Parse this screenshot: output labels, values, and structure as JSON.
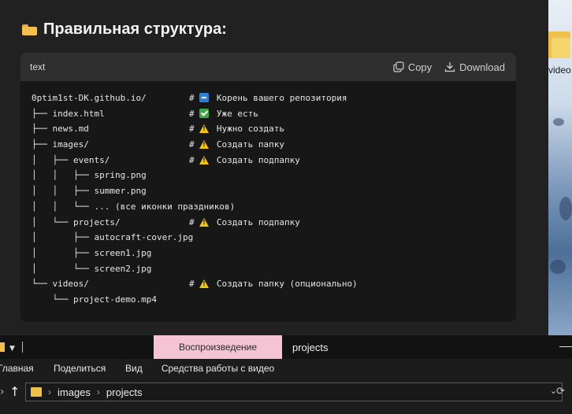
{
  "heading": {
    "text": "Правильная структура:"
  },
  "codeblock": {
    "language": "text",
    "copy_label": "Copy",
    "download_label": "Download",
    "lines": [
      {
        "tree": "0ptim1st-DK.github.io/",
        "mark": "back",
        "comment": "Корень вашего репозитория"
      },
      {
        "tree": "├── index.html",
        "mark": "check",
        "comment": "Уже есть"
      },
      {
        "tree": "├── news.md",
        "mark": "warn",
        "comment": "Нужно создать"
      },
      {
        "tree": "├── images/",
        "mark": "warn",
        "comment": "Создать папку"
      },
      {
        "tree": "│   ├── events/",
        "mark": "warn",
        "comment": "Создать подпапку"
      },
      {
        "tree": "│   │   ├── spring.png",
        "mark": "",
        "comment": ""
      },
      {
        "tree": "│   │   ├── summer.png",
        "mark": "",
        "comment": ""
      },
      {
        "tree": "│   │   └── ... (все иконки праздников)",
        "mark": "",
        "comment": ""
      },
      {
        "tree": "│   └── projects/",
        "mark": "warn",
        "comment": "Создать подпапку"
      },
      {
        "tree": "│       ├── autocraft-cover.jpg",
        "mark": "",
        "comment": ""
      },
      {
        "tree": "│       ├── screen1.jpg",
        "mark": "",
        "comment": ""
      },
      {
        "tree": "│       └── screen2.jpg",
        "mark": "",
        "comment": ""
      },
      {
        "tree": "└── videos/",
        "mark": "warn",
        "comment": "Создать папку (опционально)"
      },
      {
        "tree": "    └── project-demo.mp4",
        "mark": "",
        "comment": ""
      }
    ]
  },
  "desktop": {
    "icon_label": "video"
  },
  "explorer": {
    "context_tab": "Воспроизведение",
    "window_title": "projects",
    "ribbon": {
      "home": "Главная",
      "share": "Поделиться",
      "view": "Вид",
      "video_tools": "Средства работы с видео"
    },
    "breadcrumb": [
      "images",
      "projects"
    ]
  }
}
